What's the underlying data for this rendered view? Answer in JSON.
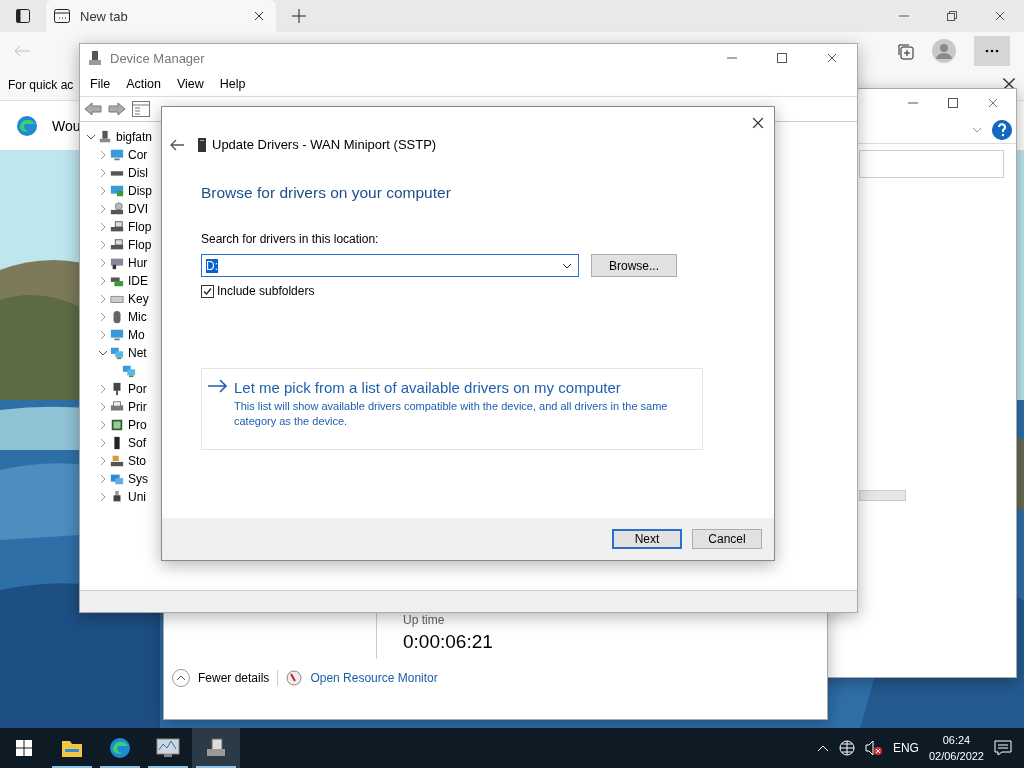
{
  "browser": {
    "tab": {
      "title": "New tab",
      "selected": true
    },
    "favorites_hint": "For quick ac",
    "page_text": "Wou"
  },
  "right_window": {
    "kind": "blank"
  },
  "task_manager": {
    "uptime_label": "Up time",
    "uptime": "0:00:06:21",
    "fewer_details": "Fewer details",
    "resource_monitor": "Open Resource Monitor"
  },
  "device_manager": {
    "title": "Device Manager",
    "menu": [
      "File",
      "Action",
      "View",
      "Help"
    ],
    "tree": {
      "label": "bigfatn",
      "kind": "root",
      "expanded": true,
      "children": [
        {
          "label": "Cor",
          "kind": "computer",
          "expanded": false
        },
        {
          "label": "Disl",
          "kind": "disk",
          "expanded": false
        },
        {
          "label": "Disp",
          "kind": "display",
          "expanded": false
        },
        {
          "label": "DVI",
          "kind": "dvd",
          "expanded": false
        },
        {
          "label": "Flop",
          "kind": "floppy",
          "expanded": false
        },
        {
          "label": "Flop",
          "kind": "floppy",
          "expanded": false
        },
        {
          "label": "Hur",
          "kind": "hid",
          "expanded": false
        },
        {
          "label": "IDE",
          "kind": "ide",
          "expanded": false
        },
        {
          "label": "Key",
          "kind": "keyboard",
          "expanded": false
        },
        {
          "label": "Mic",
          "kind": "mouse",
          "expanded": false
        },
        {
          "label": "Mo",
          "kind": "monitor",
          "expanded": false
        },
        {
          "label": "Net",
          "kind": "network",
          "expanded": true,
          "children": [
            {
              "kind": "network"
            }
          ]
        },
        {
          "label": "Por",
          "kind": "port",
          "expanded": false
        },
        {
          "label": "Prir",
          "kind": "printer",
          "expanded": false
        },
        {
          "label": "Pro",
          "kind": "processor",
          "expanded": false
        },
        {
          "label": "Sof",
          "kind": "software",
          "expanded": false
        },
        {
          "label": "Sto",
          "kind": "storage",
          "expanded": false
        },
        {
          "label": "Sys",
          "kind": "system",
          "expanded": false
        },
        {
          "label": "Uni",
          "kind": "usb",
          "expanded": false
        }
      ]
    }
  },
  "dialog": {
    "title": "Update Drivers - WAN Miniport (SSTP)",
    "heading": "Browse for drivers on your computer",
    "location_label": "Search for drivers in this location:",
    "location": {
      "value": "D:"
    },
    "browse": "Browse...",
    "include_subfolders": {
      "label": "Include subfolders",
      "checked": true
    },
    "pick_option": {
      "title": "Let me pick from a list of available drivers on my computer",
      "description": "This list will show available drivers compatible with the device, and all drivers in the same category as the device."
    },
    "buttons": [
      {
        "label": "Next",
        "default": true
      },
      {
        "label": "Cancel",
        "default": false
      }
    ]
  },
  "taskbar": {
    "apps": [
      {
        "kind": "explorer",
        "running": true,
        "selected": false
      },
      {
        "kind": "edge",
        "running": true,
        "selected": false
      },
      {
        "kind": "task-manager",
        "running": true,
        "selected": false
      },
      {
        "kind": "device-manager",
        "running": true,
        "selected": true
      }
    ],
    "language": "ENG",
    "time": "06:24",
    "date": "02/06/2022"
  }
}
